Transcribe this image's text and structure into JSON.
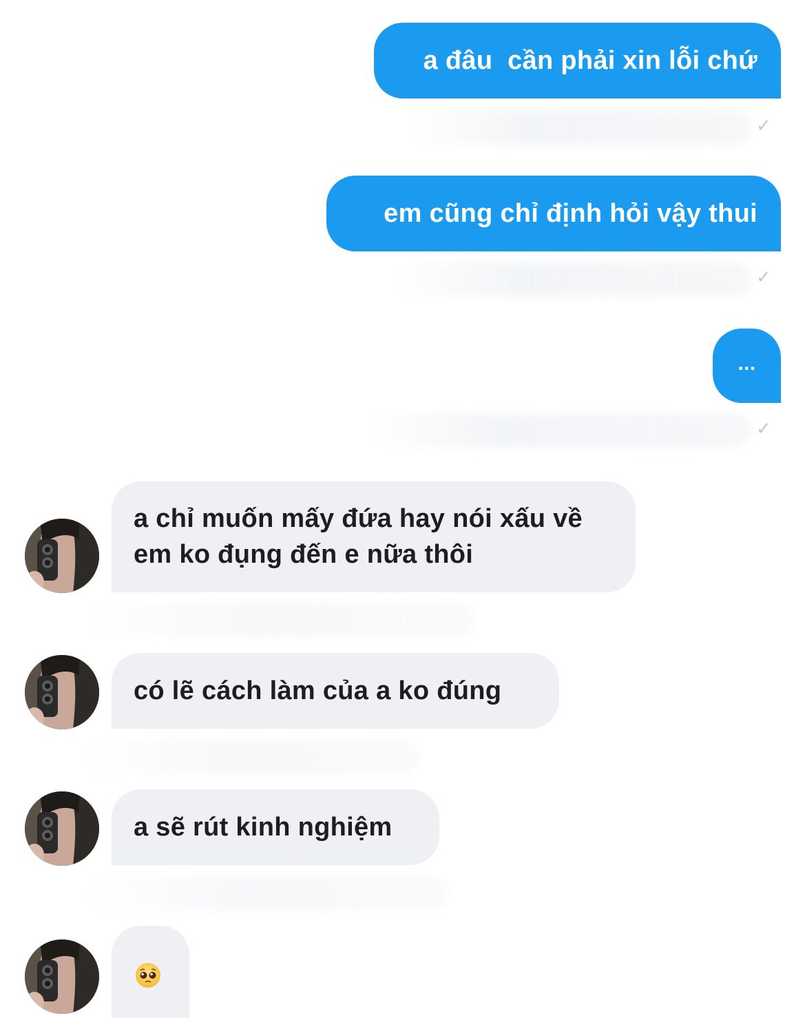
{
  "conversation": {
    "sent_messages": [
      {
        "text": "a đâu  cần phải xin lỗi chứ",
        "status": "sent-check-icon"
      },
      {
        "text": "em cũng chỉ định hỏi vậy thui",
        "status": "sent-check-icon"
      },
      {
        "text": "...",
        "status": "sent-check-icon"
      }
    ],
    "received_messages": [
      {
        "text": "a chỉ muốn mấy đứa hay nói xấu về em ko đụng đến e nữa thôi"
      },
      {
        "text": "có lẽ cách làm của a ko đúng"
      },
      {
        "text": "a sẽ rút kinh nghiệm"
      },
      {
        "emoji": "pleading-face-emoji"
      }
    ],
    "colors": {
      "sent_bubble": "#1a9bf0",
      "received_bubble": "#eef0f3",
      "received_text": "#1c1e21",
      "sent_text": "#ffffff"
    }
  }
}
